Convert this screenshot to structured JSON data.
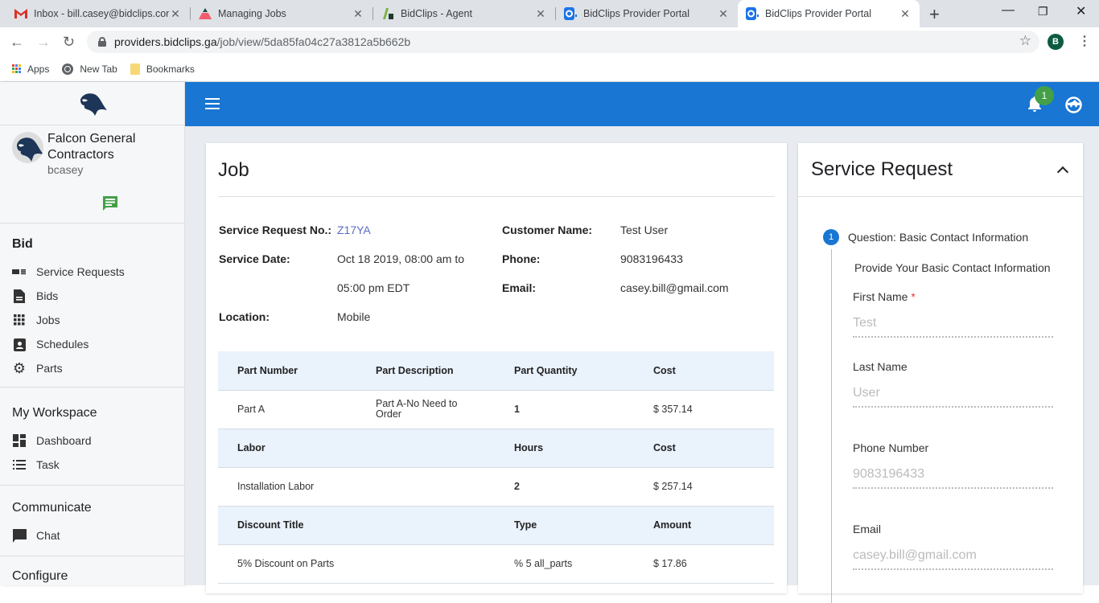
{
  "browser": {
    "tabs": [
      {
        "title": "Inbox - bill.casey@bidclips.com",
        "icon": "gmail-icon",
        "active": false
      },
      {
        "title": "Managing Jobs",
        "icon": "managing-jobs-icon",
        "active": false
      },
      {
        "title": "BidClips - Agent",
        "icon": "bidclips-agent-icon",
        "active": false
      },
      {
        "title": "BidClips Provider Portal",
        "icon": "bidclips-portal-icon",
        "active": false
      },
      {
        "title": "BidClips Provider Portal",
        "icon": "bidclips-portal-icon",
        "active": true
      }
    ],
    "url_host": "providers.bidclips.ga",
    "url_path": "/job/view/5da85fa04c27a3812a5b662b",
    "profile_initial": "B",
    "bookmarks": [
      {
        "label": "Apps",
        "icon": "apps-icon"
      },
      {
        "label": "New Tab",
        "icon": "globe-icon"
      },
      {
        "label": "Bookmarks",
        "icon": "folder-icon"
      }
    ]
  },
  "sidebar": {
    "company_name": "Falcon General Contractors",
    "username": "bcasey",
    "sections": [
      {
        "title": "Bid",
        "items": [
          {
            "label": "Service Requests",
            "icon": "service-requests-icon"
          },
          {
            "label": "Bids",
            "icon": "document-icon"
          },
          {
            "label": "Jobs",
            "icon": "grid-icon"
          },
          {
            "label": "Schedules",
            "icon": "contact-calendar-icon"
          },
          {
            "label": "Parts",
            "icon": "gear-icon"
          }
        ]
      },
      {
        "title": "My Workspace",
        "items": [
          {
            "label": "Dashboard",
            "icon": "dashboard-icon"
          },
          {
            "label": "Task",
            "icon": "list-icon"
          }
        ]
      },
      {
        "title": "Communicate",
        "items": [
          {
            "label": "Chat",
            "icon": "chat-icon"
          }
        ]
      },
      {
        "title": "Configure",
        "items": []
      }
    ]
  },
  "topbar": {
    "notification_count": "1",
    "accent": "#1976d2"
  },
  "job": {
    "title": "Job",
    "fields": {
      "service_request_no_label": "Service Request No.:",
      "service_request_no": "Z17YA",
      "service_date_label": "Service Date:",
      "service_date_line1": "Oct 18 2019, 08:00 am to",
      "service_date_line2": "05:00 pm EDT",
      "location_label": "Location:",
      "location": "Mobile",
      "customer_name_label": "Customer Name:",
      "customer_name": "Test User",
      "phone_label": "Phone:",
      "phone": "9083196433",
      "email_label": "Email:",
      "email": "casey.bill@gmail.com"
    },
    "parts_header": [
      "Part Number",
      "Part Description",
      "Part Quantity",
      "Cost"
    ],
    "parts_rows": [
      [
        "Part A",
        "Part A-No Need to Order",
        "1",
        "$ 357.14"
      ]
    ],
    "labor_header": [
      "Labor",
      "",
      "Hours",
      "Cost"
    ],
    "labor_rows": [
      [
        "Installation Labor",
        "",
        "2",
        "$ 257.14"
      ]
    ],
    "discount_header": [
      "Discount Title",
      "",
      "Type",
      "Amount"
    ],
    "discount_rows": [
      [
        "5% Discount on Parts",
        "",
        "% 5 all_parts",
        "$ 17.86"
      ]
    ]
  },
  "service_request": {
    "title": "Service Request",
    "step_number": "1",
    "step_title": "Question: Basic Contact Information",
    "step_subtitle": "Provide Your Basic Contact Information",
    "fields": [
      {
        "label": "First Name",
        "required": "*",
        "value": "Test"
      },
      {
        "label": "Last Name",
        "value": "User"
      },
      {
        "label": "Phone Number",
        "value": "9083196433"
      },
      {
        "label": "Email",
        "value": "casey.bill@gmail.com"
      }
    ]
  }
}
